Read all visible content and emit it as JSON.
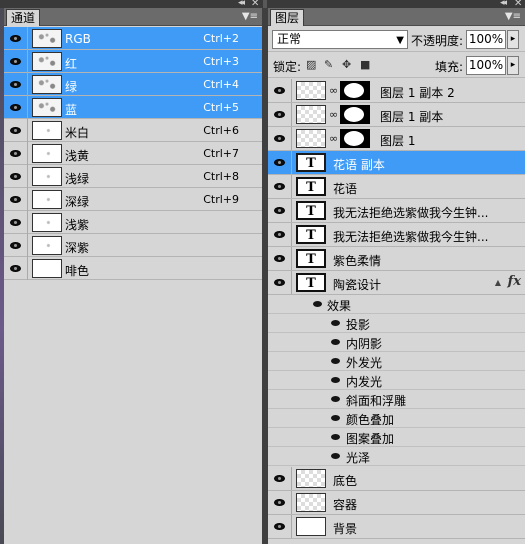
{
  "channels_panel": {
    "tab": "通道",
    "channels": [
      {
        "name": "RGB",
        "shortcut": "Ctrl+2",
        "selected": true
      },
      {
        "name": "红",
        "shortcut": "Ctrl+3",
        "selected": true
      },
      {
        "name": "绿",
        "shortcut": "Ctrl+4",
        "selected": true
      },
      {
        "name": "蓝",
        "shortcut": "Ctrl+5",
        "selected": true
      },
      {
        "name": "米白",
        "shortcut": "Ctrl+6",
        "selected": false
      },
      {
        "name": "浅黄",
        "shortcut": "Ctrl+7",
        "selected": false
      },
      {
        "name": "浅绿",
        "shortcut": "Ctrl+8",
        "selected": false
      },
      {
        "name": "深绿",
        "shortcut": "Ctrl+9",
        "selected": false
      },
      {
        "name": "浅紫",
        "shortcut": "",
        "selected": false
      },
      {
        "name": "深紫",
        "shortcut": "",
        "selected": false
      },
      {
        "name": "啡色",
        "shortcut": "",
        "selected": false
      }
    ]
  },
  "layers_panel": {
    "tab": "图层",
    "blend_mode": "正常",
    "opacity_label": "不透明度:",
    "opacity_value": "100%",
    "lock_label": "锁定:",
    "fill_label": "填充:",
    "fill_value": "100%",
    "layers": [
      {
        "name": "图层 1 副本 2",
        "kind": "masked"
      },
      {
        "name": "图层 1 副本",
        "kind": "masked"
      },
      {
        "name": "图层 1",
        "kind": "masked"
      },
      {
        "name": "花语 副本",
        "kind": "text",
        "selected": true
      },
      {
        "name": "花语",
        "kind": "text"
      },
      {
        "name": "我无法拒绝选紫做我今生钟...",
        "kind": "text"
      },
      {
        "name": "我无法拒绝选紫做我今生钟...",
        "kind": "text"
      },
      {
        "name": "紫色柔情",
        "kind": "text"
      },
      {
        "name": "陶瓷设计",
        "kind": "text",
        "fx": "fx"
      }
    ],
    "effects_label": "效果",
    "effects": [
      "投影",
      "内阴影",
      "外发光",
      "内发光",
      "斜面和浮雕",
      "颜色叠加",
      "图案叠加",
      "光泽"
    ],
    "bottom_layers": [
      {
        "name": "底色",
        "kind": "checker"
      },
      {
        "name": "容器",
        "kind": "checker"
      },
      {
        "name": "背景",
        "kind": "white"
      }
    ]
  },
  "colors": {
    "selection": "#3f9bf5",
    "panel_bg": "#d6d6d6"
  }
}
